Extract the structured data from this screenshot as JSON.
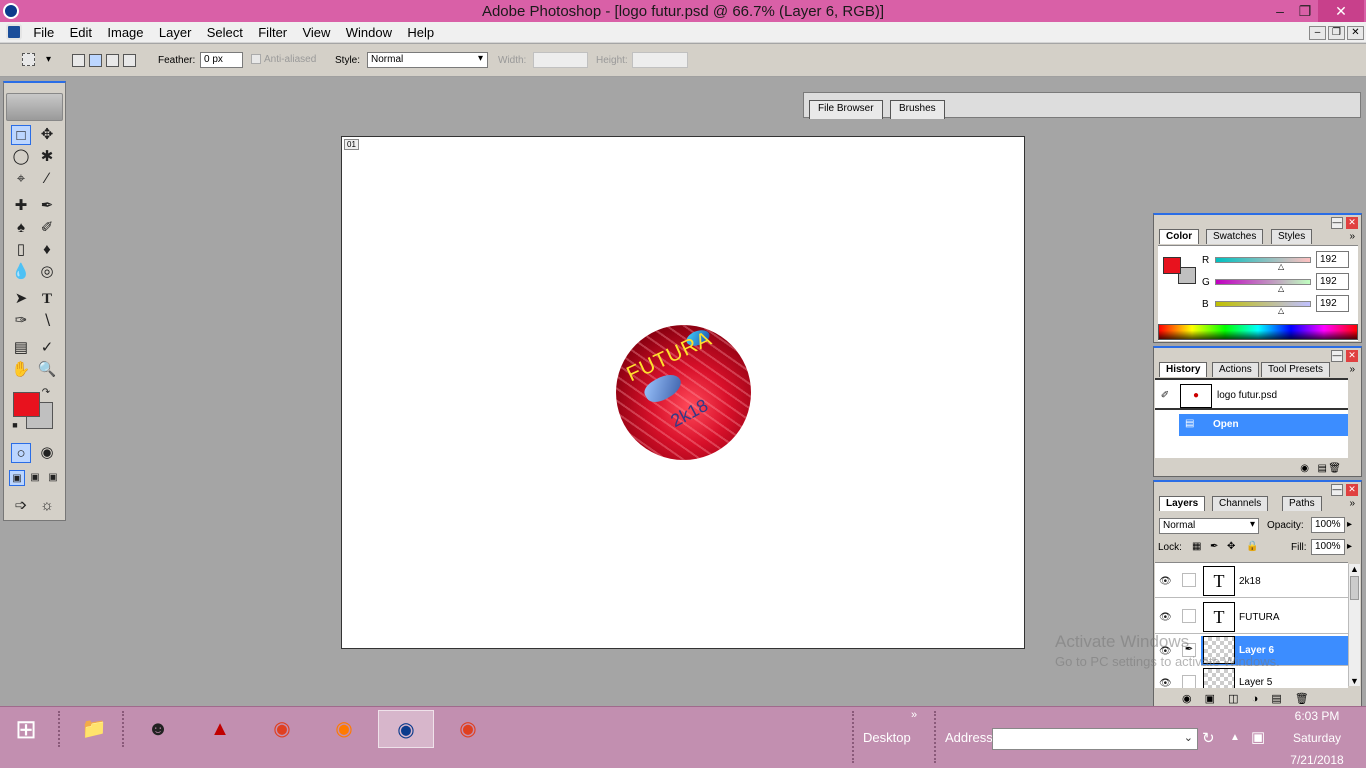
{
  "window": {
    "title": "Adobe Photoshop - [logo futur.psd @ 66.7% (Layer 6, RGB)]"
  },
  "menu": [
    "File",
    "Edit",
    "Image",
    "Layer",
    "Select",
    "Filter",
    "View",
    "Window",
    "Help"
  ],
  "options": {
    "feather_label": "Feather:",
    "feather_value": "0 px",
    "antialiased_label": "Anti-aliased",
    "style_label": "Style:",
    "style_value": "Normal",
    "width_label": "Width:",
    "height_label": "Height:"
  },
  "palette_well": {
    "tabs": [
      "File Browser",
      "Brushes"
    ]
  },
  "canvas": {
    "tag": "01",
    "logo_text": "FUTURA",
    "logo_year": "2k18",
    "fg_color": "#e8121e"
  },
  "color_panel": {
    "tabs": [
      "Color",
      "Swatches",
      "Styles"
    ],
    "r_label": "R",
    "g_label": "G",
    "b_label": "B",
    "r": "192",
    "g": "192",
    "b": "192"
  },
  "history_panel": {
    "tabs": [
      "History",
      "Actions",
      "Tool Presets"
    ],
    "snapshot": "logo futur.psd",
    "step": "Open"
  },
  "layers_panel": {
    "tabs": [
      "Layers",
      "Channels",
      "Paths"
    ],
    "blend_mode": "Normal",
    "opacity_label": "Opacity:",
    "opacity": "100%",
    "lock_label": "Lock:",
    "fill_label": "Fill:",
    "fill": "100%",
    "layers": [
      "2k18",
      "FUTURA",
      "Layer 6",
      "Layer 5"
    ]
  },
  "watermark": {
    "line1": "Activate Windows",
    "line2": "Go to PC settings to activate Windows."
  },
  "taskbar": {
    "desktop": "Desktop",
    "address": "Address",
    "time": "6:03 PM",
    "day": "Saturday",
    "date": "7/21/2018"
  }
}
